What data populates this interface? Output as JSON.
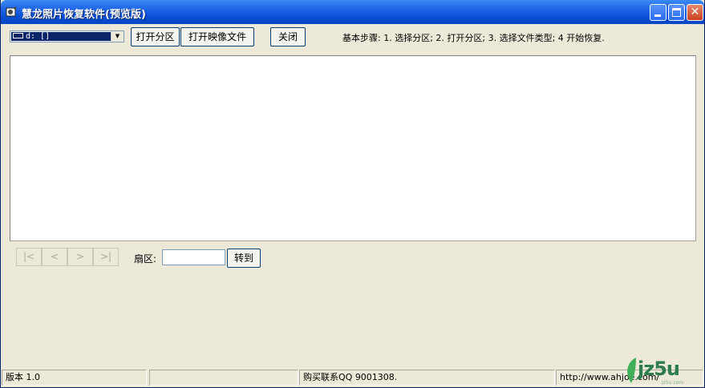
{
  "window": {
    "title": "慧龙照片恢复软件(预览版)"
  },
  "toolbar": {
    "drive_value": "d: []",
    "open_partition": "打开分区",
    "open_image": "打开映像文件",
    "close": "关闭",
    "steps": "基本步骤: 1. 选择分区; 2. 打开分区; 3. 选择文件类型; 4 开始恢复."
  },
  "navigation": {
    "first": "|<",
    "prev": "<",
    "next": ">",
    "last": ">|",
    "sector_label": "扇区:",
    "sector_value": "",
    "goto": "转到"
  },
  "statusbar": {
    "version": "版本 1.0",
    "empty": "",
    "purchase": "购买联系QQ 9001308.",
    "url": "http://www.ahjoe.com/"
  },
  "watermark": {
    "text": "jz5u",
    "sub": "jz5u.com"
  }
}
